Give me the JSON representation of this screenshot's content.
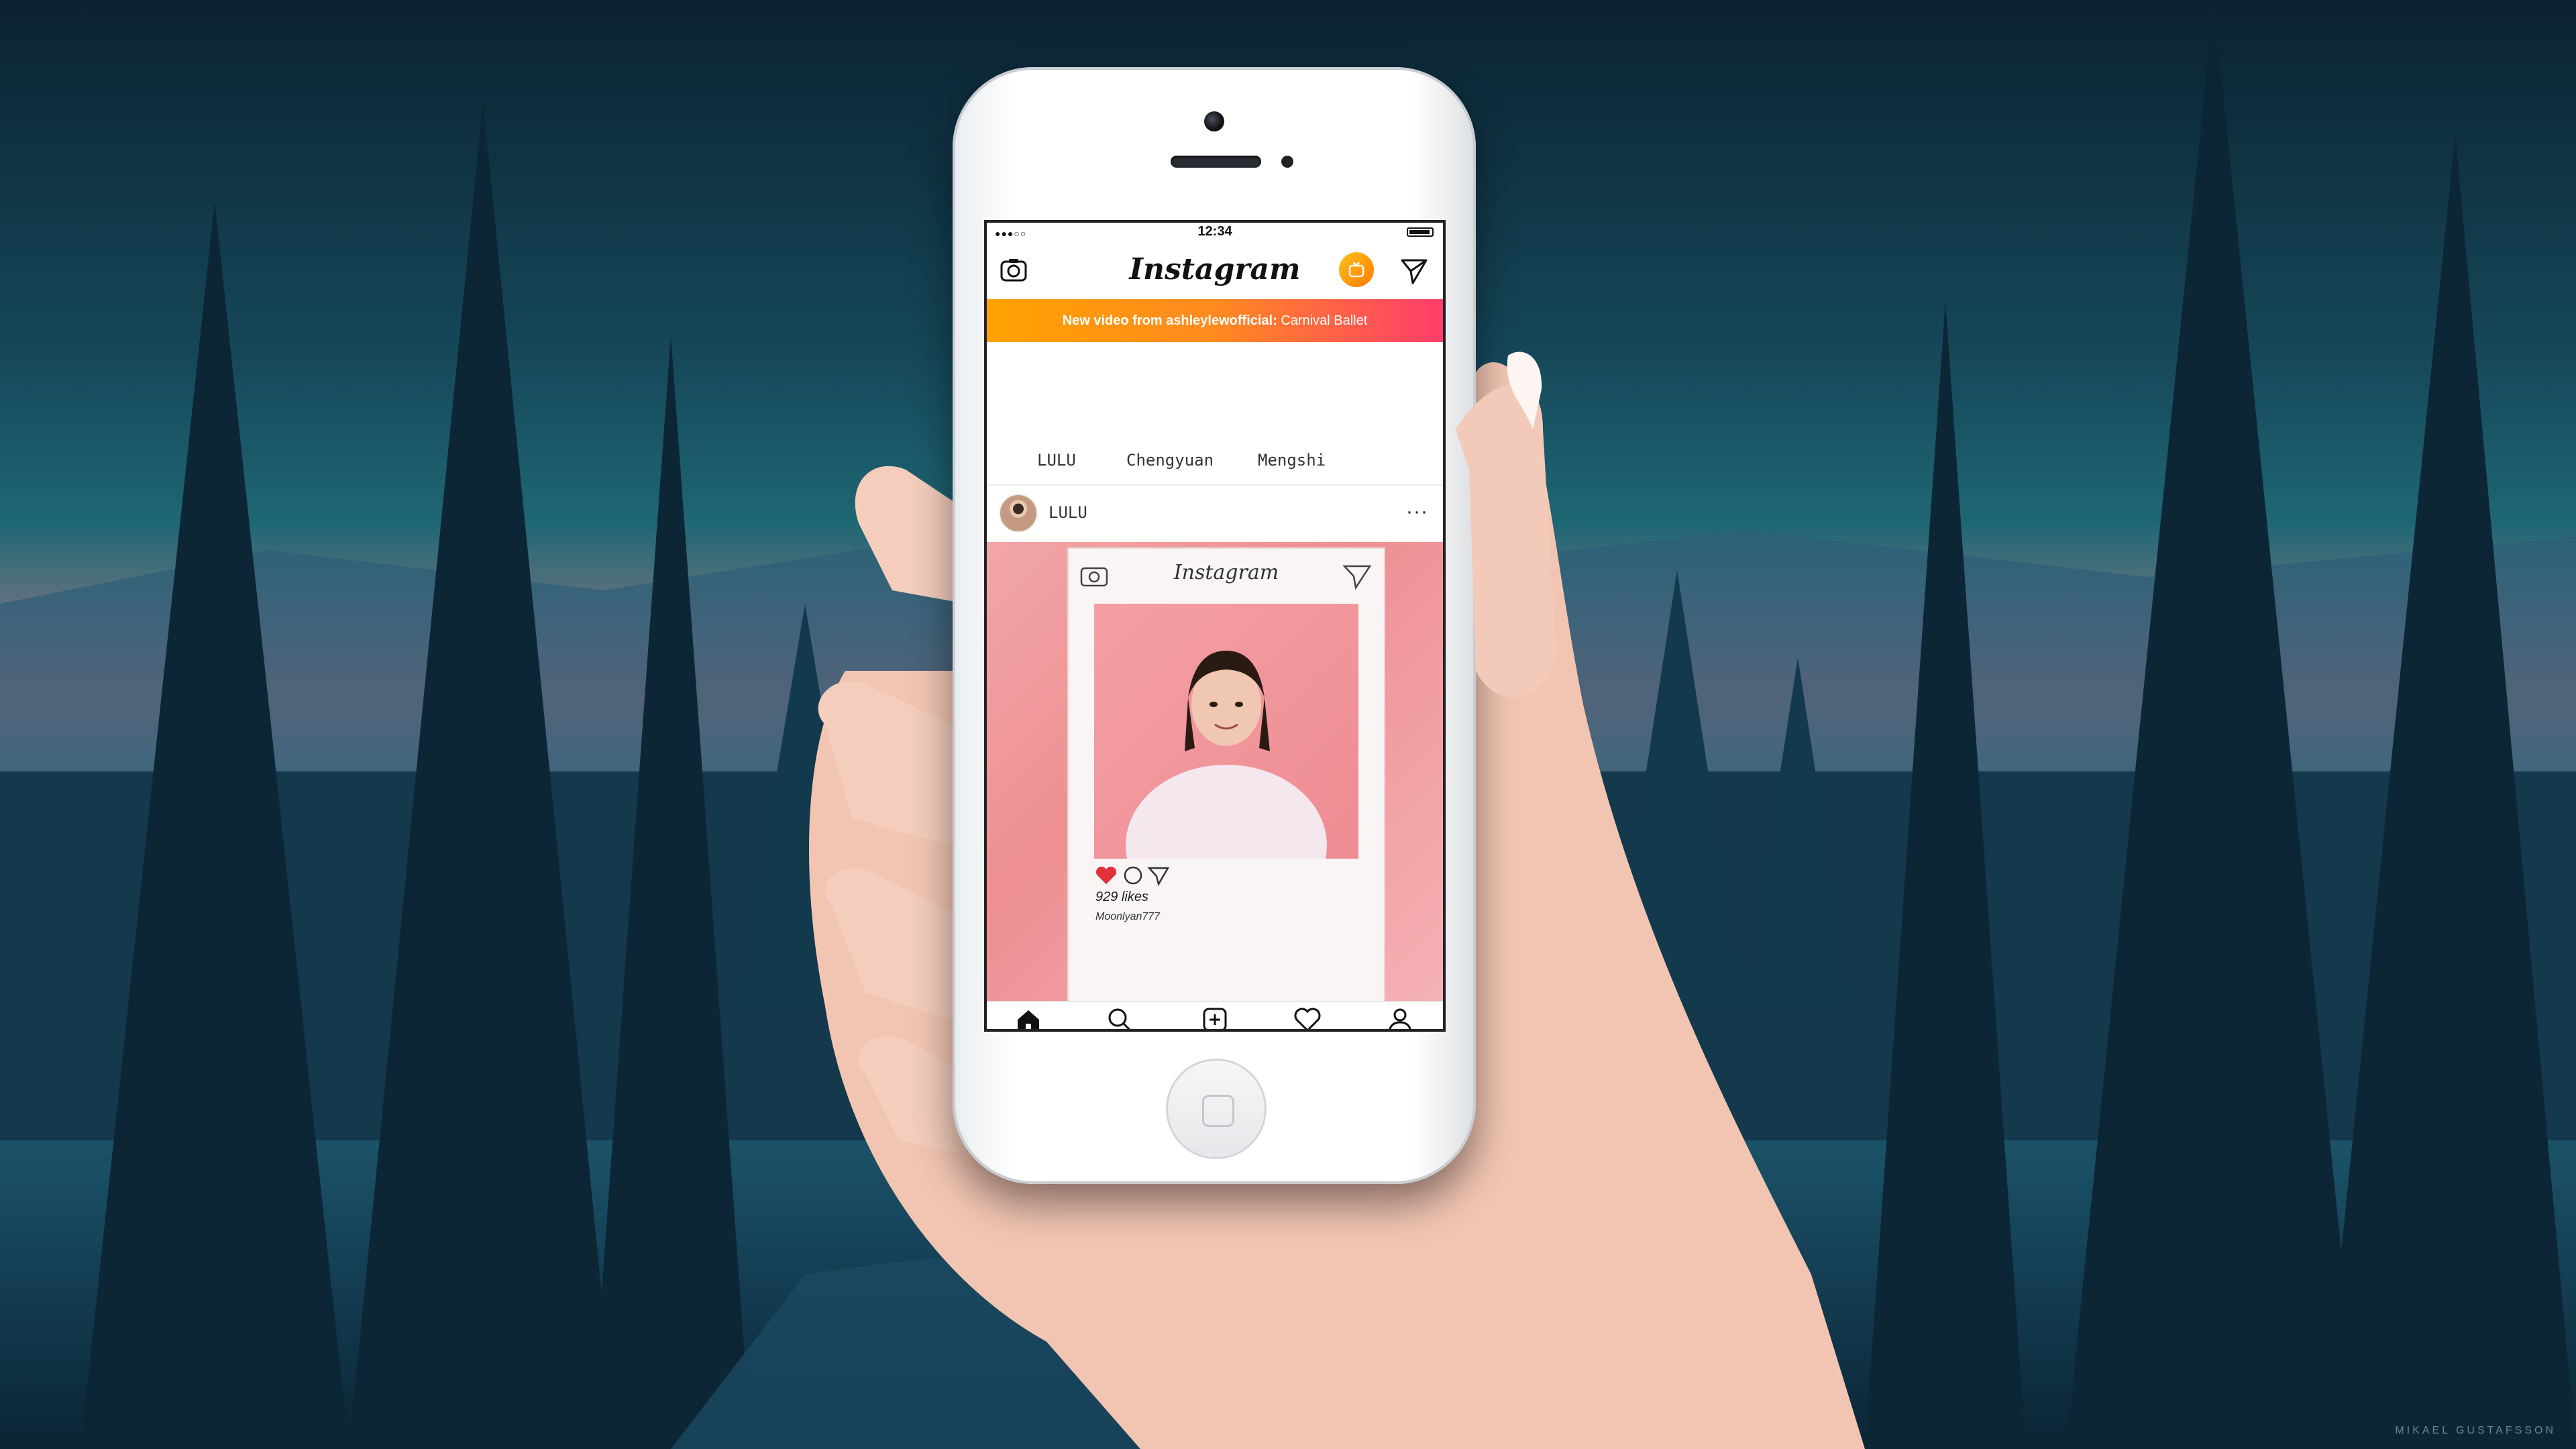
{
  "scene": {
    "credit": "MIKAEL GUSTAFSSON"
  },
  "status_bar": {
    "time": "12:34",
    "signal": "●●●○○"
  },
  "nav": {
    "logo": "Instagram",
    "camera_icon": "camera-icon",
    "igtv_icon": "igtv-icon",
    "direct_icon": "paper-plane-icon"
  },
  "banner": {
    "prefix": "New video from ashleylewofficial:",
    "title": "Carnival Ballet"
  },
  "stories": [
    {
      "label": "LULU"
    },
    {
      "label": "Chengyuan"
    },
    {
      "label": "Mengshi"
    }
  ],
  "post": {
    "username": "LULU",
    "more": "···",
    "frame_title": "Instagram",
    "frame_likes": "929 likes",
    "frame_caption": "Moonlyan777"
  },
  "tabbar": {
    "items": [
      "home-icon",
      "search-icon",
      "add-icon",
      "heart-icon",
      "profile-icon"
    ]
  },
  "colors": {
    "banner_start": "#ffa200",
    "banner_end": "#ff3d6b",
    "igtv": "#ff7a00",
    "sky": "#1f6f7a"
  }
}
